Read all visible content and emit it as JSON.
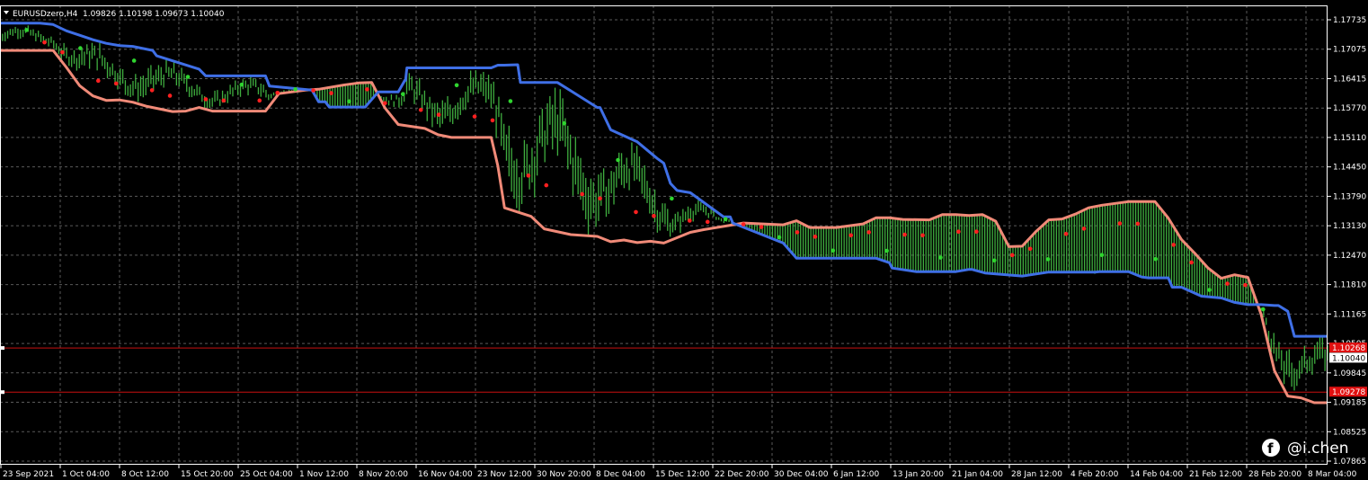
{
  "header": {
    "symbol_timeframe": "EURUSDzero,H4",
    "ohlc": "1.09826 1.10198 1.09673 1.10040"
  },
  "watermark": {
    "icon": "facebook-icon",
    "text": "@i.chen"
  },
  "colors": {
    "background": "#000000",
    "grid": "#5a5a5a",
    "axis": "#ffffff",
    "upper_band": "#3f6fe6",
    "lower_band": "#f08a78",
    "candles": "#3fae3f",
    "dot_up": "#2fd52f",
    "dot_down": "#ff2020",
    "hline": "#c81010",
    "current_price_bg": "#ffffff"
  },
  "chart_data": {
    "type": "line",
    "title": "",
    "xlabel": "",
    "ylabel": "",
    "ylim": [
      1.0765,
      1.1795
    ],
    "grid": true,
    "price_axis_ticks": [
      "1.17735",
      "1.17075",
      "1.16415",
      "1.15770",
      "1.15110",
      "1.14450",
      "1.13790",
      "1.13130",
      "1.12470",
      "1.11810",
      "1.11165",
      "1.10505",
      "1.09845",
      "1.09185",
      "1.08525",
      "1.07865"
    ],
    "time_axis_ticks": [
      "23 Sep 2021",
      "1 Oct 04:00",
      "8 Oct 12:00",
      "15 Oct 20:00",
      "25 Oct 04:00",
      "1 Nov 12:00",
      "8 Nov 20:00",
      "16 Nov 04:00",
      "23 Nov 12:00",
      "30 Nov 20:00",
      "8 Dec 04:00",
      "15 Dec 12:00",
      "22 Dec 20:00",
      "30 Dec 04:00",
      "6 Jan 12:00",
      "13 Jan 20:00",
      "21 Jan 04:00",
      "28 Jan 12:00",
      "4 Feb 20:00",
      "14 Feb 04:00",
      "21 Feb 12:00",
      "28 Feb 20:00",
      "8 Mar 04:00"
    ],
    "horizontal_lines": [
      {
        "label": "1.10268",
        "value": 1.10268
      },
      {
        "label": "1.09278",
        "value": 1.09278
      }
    ],
    "current_price": {
      "label": "1.10040",
      "value": 1.1004
    },
    "series": [
      {
        "name": "",
        "style": "upper-band",
        "x": [
          0,
          0.015,
          0.03,
          0.04,
          0.05,
          0.06,
          0.07,
          0.08,
          0.09,
          0.1,
          0.115,
          0.118,
          0.15,
          0.155,
          0.2,
          0.203,
          0.235,
          0.24,
          0.245,
          0.248,
          0.275,
          0.285,
          0.3,
          0.305,
          0.3055,
          0.3065,
          0.37,
          0.375,
          0.38,
          0.39,
          0.392,
          0.42,
          0.45,
          0.452,
          0.46,
          0.48,
          0.495,
          0.5,
          0.505,
          0.51,
          0.52,
          0.545,
          0.55,
          0.552,
          0.59,
          0.6,
          0.66,
          0.67,
          0.672,
          0.69,
          0.72,
          0.73,
          0.732,
          0.742,
          0.77,
          0.79,
          0.815,
          0.82,
          0.825,
          0.828,
          0.84,
          0.85,
          0.86,
          0.865,
          0.88,
          0.883,
          0.885,
          0.89,
          0.905,
          0.92,
          0.93,
          0.94,
          0.95,
          0.96,
          0.963,
          0.97,
          0.975,
          1.0
        ],
        "y": [
          1.1755,
          1.1755,
          1.1755,
          1.1752,
          1.1738,
          1.1728,
          1.1718,
          1.171,
          1.1705,
          1.1703,
          1.1694,
          1.1682,
          1.1652,
          1.1637,
          1.1637,
          1.1614,
          1.1605,
          1.1579,
          1.1579,
          1.1567,
          1.1567,
          1.1601,
          1.1601,
          1.1627,
          1.1627,
          1.1655,
          1.1655,
          1.1661,
          1.1661,
          1.1662,
          1.1622,
          1.1622,
          1.1566,
          1.1566,
          1.1516,
          1.1489,
          1.1452,
          1.1441,
          1.1396,
          1.138,
          1.1375,
          1.1321,
          1.1321,
          1.1307,
          1.1262,
          1.1228,
          1.1228,
          1.1218,
          1.1206,
          1.1198,
          1.1198,
          1.1203,
          1.1203,
          1.1195,
          1.1188,
          1.1197,
          1.1197,
          1.1197,
          1.1197,
          1.1198,
          1.1198,
          1.1198,
          1.1186,
          1.1184,
          1.1184,
          1.1163,
          1.1163,
          1.1163,
          1.1143,
          1.1139,
          1.1129,
          1.1124,
          1.1124,
          1.1122,
          1.1122,
          1.1109,
          1.1053,
          1.1053
        ]
      },
      {
        "name": "",
        "style": "lower-band",
        "x": [
          0,
          0.02,
          0.04,
          0.05,
          0.06,
          0.07,
          0.08,
          0.09,
          0.1,
          0.11,
          0.13,
          0.14,
          0.15,
          0.16,
          0.2,
          0.21,
          0.23,
          0.24,
          0.26,
          0.27,
          0.28,
          0.29,
          0.3,
          0.32,
          0.33,
          0.34,
          0.37,
          0.375,
          0.38,
          0.4,
          0.41,
          0.43,
          0.45,
          0.46,
          0.47,
          0.48,
          0.49,
          0.5,
          0.52,
          0.53,
          0.55,
          0.56,
          0.59,
          0.6,
          0.61,
          0.63,
          0.65,
          0.66,
          0.67,
          0.68,
          0.7,
          0.71,
          0.72,
          0.73,
          0.74,
          0.75,
          0.76,
          0.77,
          0.78,
          0.79,
          0.8,
          0.81,
          0.82,
          0.83,
          0.84,
          0.85,
          0.86,
          0.87,
          0.88,
          0.89,
          0.9,
          0.91,
          0.92,
          0.93,
          0.94,
          0.95,
          0.96,
          0.97,
          0.98,
          0.99,
          1.0
        ],
        "y": [
          1.1694,
          1.1694,
          1.1694,
          1.1656,
          1.1615,
          1.1592,
          1.1582,
          1.1583,
          1.1578,
          1.1569,
          1.1557,
          1.1558,
          1.1566,
          1.1558,
          1.1558,
          1.1597,
          1.1605,
          1.1607,
          1.1617,
          1.1621,
          1.1622,
          1.1565,
          1.1528,
          1.1519,
          1.1505,
          1.1499,
          1.1499,
          1.1435,
          1.1341,
          1.1322,
          1.1294,
          1.1281,
          1.1277,
          1.1265,
          1.1269,
          1.1263,
          1.1266,
          1.1262,
          1.1286,
          1.1292,
          1.1302,
          1.1307,
          1.1303,
          1.1312,
          1.1297,
          1.1297,
          1.1305,
          1.1319,
          1.1319,
          1.1315,
          1.1314,
          1.1326,
          1.1326,
          1.1324,
          1.1326,
          1.1311,
          1.1254,
          1.1255,
          1.1287,
          1.1314,
          1.1316,
          1.1327,
          1.1341,
          1.1347,
          1.1351,
          1.1355,
          1.1355,
          1.1355,
          1.1318,
          1.127,
          1.1239,
          1.1206,
          1.1183,
          1.1191,
          1.1185,
          1.1102,
          1.0976,
          1.0919,
          1.0915,
          1.0904,
          1.0904
        ]
      }
    ]
  }
}
